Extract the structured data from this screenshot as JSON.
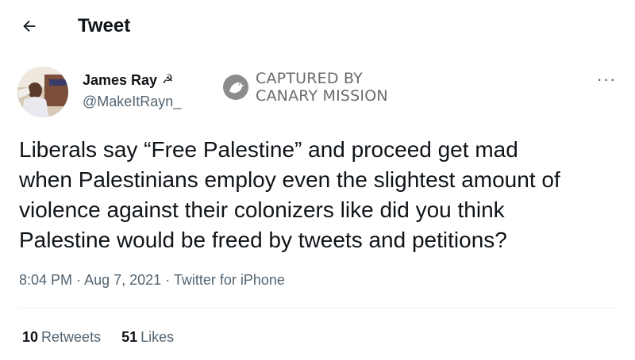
{
  "header": {
    "back_icon": "arrow-left-icon",
    "title": "Tweet"
  },
  "tweet": {
    "author_name": "James Ray",
    "author_emoji": "☭",
    "author_handle": "@MakeItRayn_",
    "more_icon": "ellipsis-icon",
    "more_label": "···",
    "text": "Liberals say “Free Palestine” and proceed get mad\nwhen Palestinians employ even the slightest amount of\nviolence against their colonizers like did you think\nPalestine would be freed by tweets and petitions?",
    "time": "8:04 PM",
    "separator": "·",
    "date": "Aug 7, 2021",
    "source": "Twitter for iPhone",
    "retweets_count": "10",
    "retweets_label": "Retweets",
    "likes_count": "51",
    "likes_label": "Likes"
  },
  "watermark": {
    "line1": "CAPTURED BY",
    "line2": "CANARY MISSION",
    "logo_icon": "canary-bird-icon"
  },
  "colors": {
    "text_primary": "#0f1419",
    "text_secondary": "#536471",
    "divider": "#eff3f4",
    "watermark": "#6b6b6b"
  }
}
